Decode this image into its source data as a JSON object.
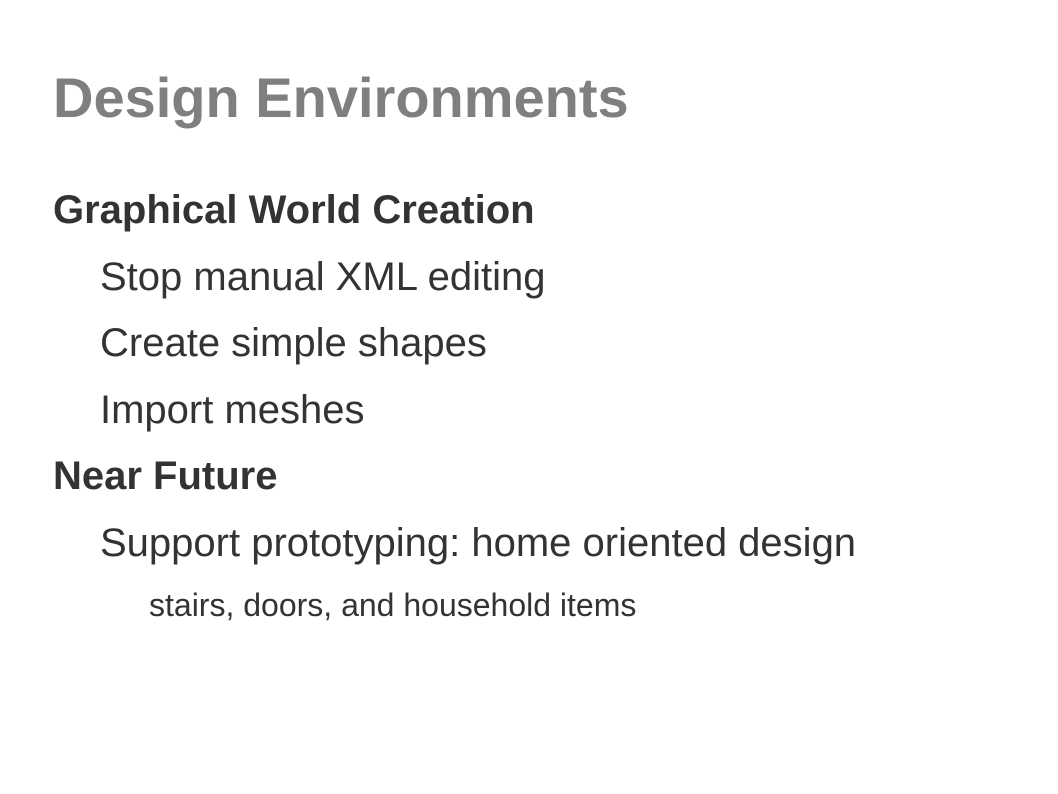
{
  "slide": {
    "title": "Design Environments",
    "sections": [
      {
        "heading": "Graphical World Creation",
        "items": [
          "Stop manual XML editing",
          "Create simple shapes",
          "Import meshes"
        ]
      },
      {
        "heading": "Near Future",
        "items": [
          "Support prototyping: home oriented design"
        ],
        "subitems": [
          "stairs, doors, and household items"
        ]
      }
    ]
  }
}
